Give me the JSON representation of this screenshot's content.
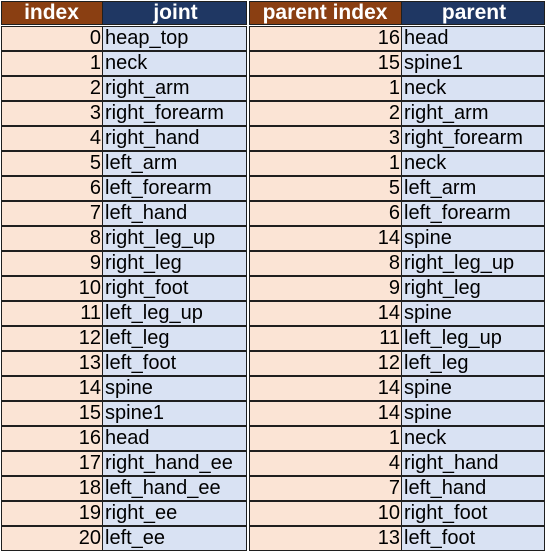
{
  "headers": {
    "index": "index",
    "joint": "joint",
    "parent_index": "parent index",
    "parent": "parent"
  },
  "rows": [
    {
      "index": "0",
      "joint": "heap_top",
      "parent_index": "16",
      "parent": "head"
    },
    {
      "index": "1",
      "joint": "neck",
      "parent_index": "15",
      "parent": "spine1"
    },
    {
      "index": "2",
      "joint": "right_arm",
      "parent_index": "1",
      "parent": "neck"
    },
    {
      "index": "3",
      "joint": "right_forearm",
      "parent_index": "2",
      "parent": "right_arm"
    },
    {
      "index": "4",
      "joint": "right_hand",
      "parent_index": "3",
      "parent": "right_forearm"
    },
    {
      "index": "5",
      "joint": "left_arm",
      "parent_index": "1",
      "parent": "neck"
    },
    {
      "index": "6",
      "joint": "left_forearm",
      "parent_index": "5",
      "parent": "left_arm"
    },
    {
      "index": "7",
      "joint": "left_hand",
      "parent_index": "6",
      "parent": "left_forearm"
    },
    {
      "index": "8",
      "joint": "right_leg_up",
      "parent_index": "14",
      "parent": "spine"
    },
    {
      "index": "9",
      "joint": "right_leg",
      "parent_index": "8",
      "parent": "right_leg_up"
    },
    {
      "index": "10",
      "joint": "right_foot",
      "parent_index": "9",
      "parent": "right_leg"
    },
    {
      "index": "11",
      "joint": "left_leg_up",
      "parent_index": "14",
      "parent": "spine"
    },
    {
      "index": "12",
      "joint": "left_leg",
      "parent_index": "11",
      "parent": "left_leg_up"
    },
    {
      "index": "13",
      "joint": "left_foot",
      "parent_index": "12",
      "parent": "left_leg"
    },
    {
      "index": "14",
      "joint": "spine",
      "parent_index": "14",
      "parent": "spine"
    },
    {
      "index": "15",
      "joint": "spine1",
      "parent_index": "14",
      "parent": "spine"
    },
    {
      "index": "16",
      "joint": "head",
      "parent_index": "1",
      "parent": "neck"
    },
    {
      "index": "17",
      "joint": "right_hand_ee",
      "parent_index": "4",
      "parent": "right_hand"
    },
    {
      "index": "18",
      "joint": "left_hand_ee",
      "parent_index": "7",
      "parent": "left_hand"
    },
    {
      "index": "19",
      "joint": "right_ee",
      "parent_index": "10",
      "parent": "right_foot"
    },
    {
      "index": "20",
      "joint": "left_ee",
      "parent_index": "13",
      "parent": "left_foot"
    }
  ],
  "colors": {
    "index_header": "#8a3f12",
    "name_header": "#1f3763",
    "index_cell": "#fbe4d5",
    "name_cell": "#d9e2f3"
  }
}
